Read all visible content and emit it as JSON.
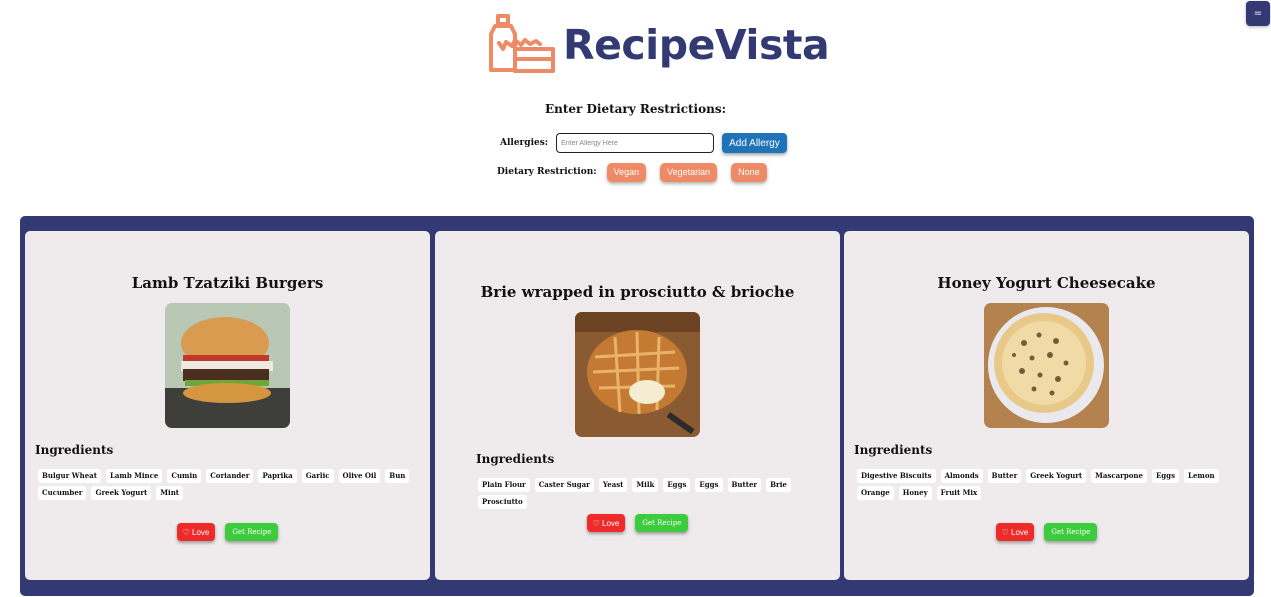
{
  "header": {
    "menu_icon": "hamburger-icon",
    "menu_glyph": "=",
    "logo_icon": "grocery-bag-icon",
    "brand": "RecipeVista"
  },
  "diet": {
    "title": "Enter Dietary Restrictions:",
    "allergies_label": "Allergies:",
    "allergy_placeholder": "Enter Allergy Here",
    "add_allergy": "Add Allergy",
    "restriction_label": "Dietary Restriction:",
    "options": [
      "Vegan",
      "Vegetarian",
      "None"
    ]
  },
  "colors": {
    "brand": "#333a73",
    "accent_orange": "#ee8a66",
    "blue": "#1f73b8",
    "love_red": "#ee2a2a",
    "recipe_green": "#3dcc3d"
  },
  "recipes": [
    {
      "title": "Lamb Tzatziki Burgers",
      "image_icon": "burger-photo",
      "ingredients_heading": "Ingredients",
      "ingredients": [
        "Bulgur Wheat",
        "Lamb Mince",
        "Cumin",
        "Coriander",
        "Paprika",
        "Garlic",
        "Olive Oil",
        "Bun",
        "Cucumber",
        "Greek Yogurt",
        "Mint"
      ],
      "love": "♡ Love",
      "get": "Get Recipe"
    },
    {
      "title": "Brie wrapped in prosciutto & brioche",
      "image_icon": "brioche-photo",
      "ingredients_heading": "Ingredients",
      "ingredients": [
        "Plain Flour",
        "Caster Sugar",
        "Yeast",
        "Milk",
        "Eggs",
        "Eggs",
        "Butter",
        "Brie",
        "Prosciutto"
      ],
      "love": "♡ Love",
      "get": "Get Recipe"
    },
    {
      "title": "Honey Yogurt Cheesecake",
      "image_icon": "cheesecake-photo",
      "ingredients_heading": "Ingredients",
      "ingredients": [
        "Digestive Biscuits",
        "Almonds",
        "Butter",
        "Greek Yogurt",
        "Mascarpone",
        "Eggs",
        "Lemon",
        "Orange",
        "Honey",
        "Fruit Mix"
      ],
      "love": "♡ Love",
      "get": "Get Recipe"
    }
  ]
}
